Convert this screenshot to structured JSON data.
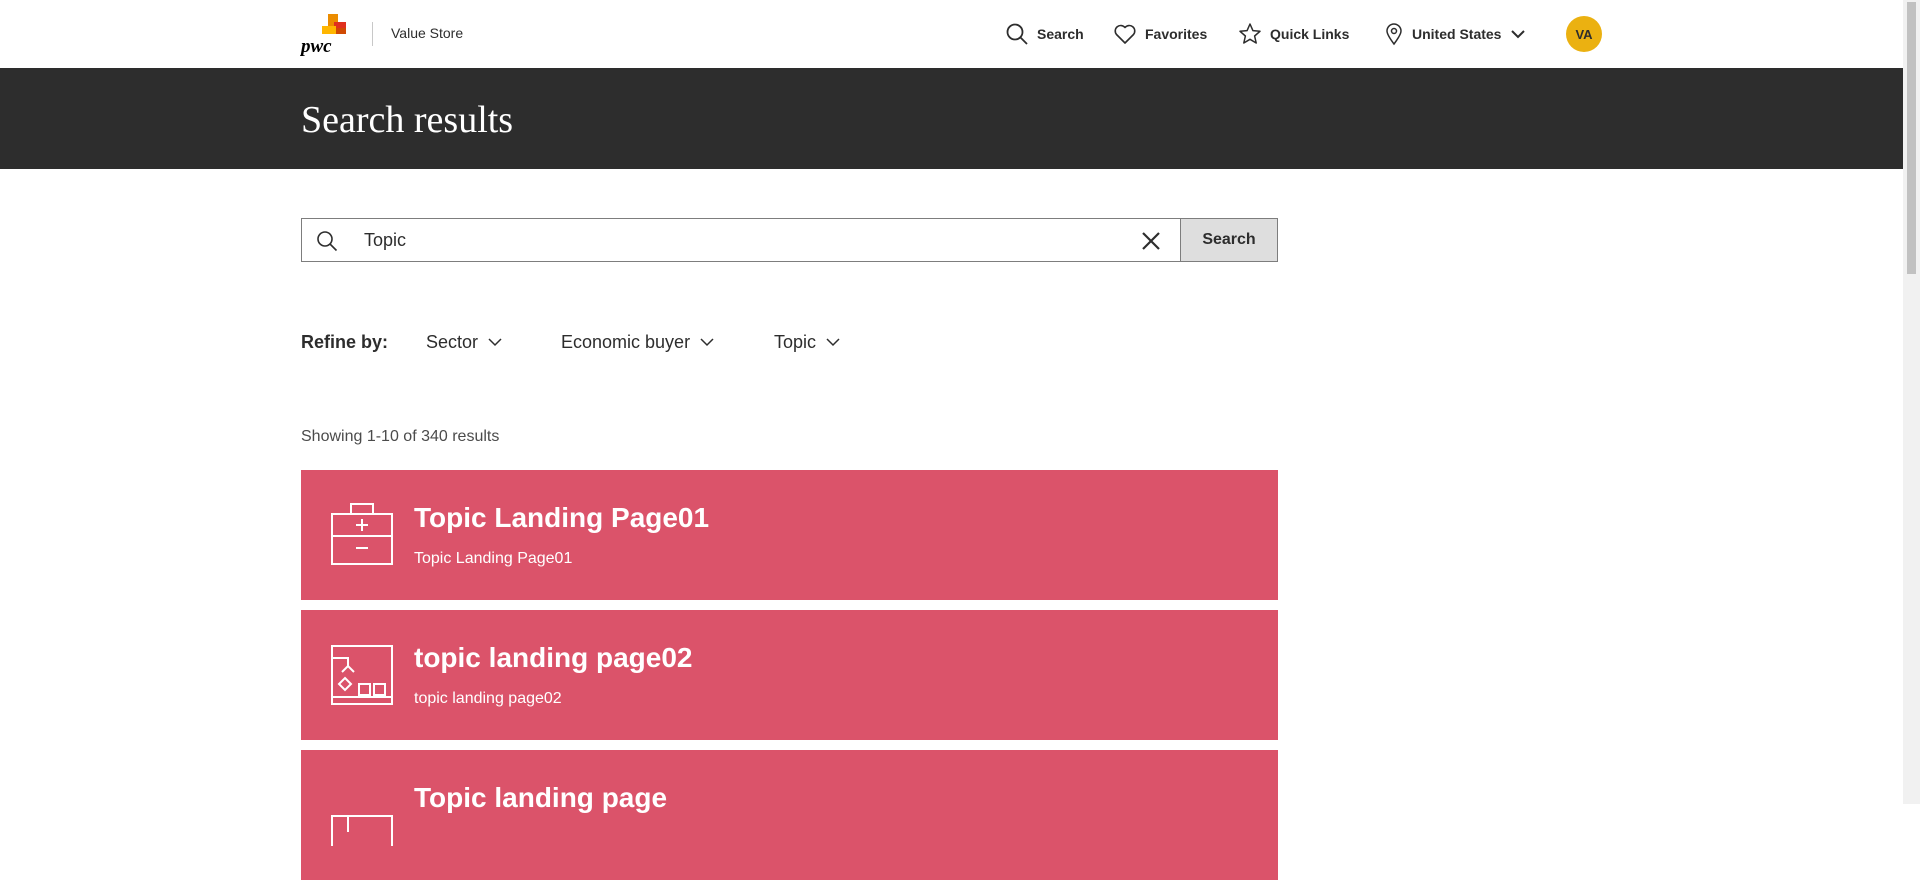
{
  "header": {
    "store_name": "Value Store",
    "nav": {
      "search": "Search",
      "favorites": "Favorites",
      "quick_links": "Quick Links",
      "region": "United States"
    },
    "avatar_initials": "VA"
  },
  "banner": {
    "title": "Search results"
  },
  "search": {
    "value": "Topic",
    "button_label": "Search"
  },
  "refine": {
    "label": "Refine by:",
    "filters": [
      "Sector",
      "Economic buyer",
      "Topic"
    ]
  },
  "results": {
    "count_text": "Showing 1-10 of 340 results",
    "items": [
      {
        "title": "Topic Landing Page01",
        "subtitle": "Topic Landing Page01",
        "icon": "first-aid-kit-icon"
      },
      {
        "title": "topic landing page02",
        "subtitle": "topic landing page02",
        "icon": "warehouse-crane-icon"
      },
      {
        "title": "Topic landing page",
        "subtitle": "",
        "icon": "browser-window-icon"
      }
    ]
  },
  "colors": {
    "banner": "#2d2d2d",
    "card": "#db536a",
    "avatar": "#ebb111",
    "search_button": "#dedede"
  }
}
